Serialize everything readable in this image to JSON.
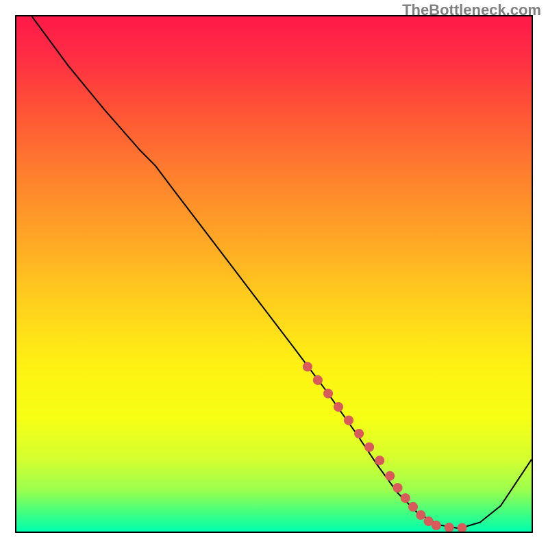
{
  "watermark": "TheBottleneck.com",
  "chart_data": {
    "type": "line",
    "title": "",
    "xlabel": "",
    "ylabel": "",
    "xlim": [
      0,
      100
    ],
    "ylim": [
      0,
      100
    ],
    "background_gradient": {
      "stops": [
        {
          "offset": 0.0,
          "color": "#ff1a49"
        },
        {
          "offset": 0.08,
          "color": "#ff2e44"
        },
        {
          "offset": 0.18,
          "color": "#ff5236"
        },
        {
          "offset": 0.3,
          "color": "#ff7d2e"
        },
        {
          "offset": 0.42,
          "color": "#ffa326"
        },
        {
          "offset": 0.55,
          "color": "#ffce1d"
        },
        {
          "offset": 0.68,
          "color": "#fff213"
        },
        {
          "offset": 0.78,
          "color": "#f6ff14"
        },
        {
          "offset": 0.86,
          "color": "#d4ff30"
        },
        {
          "offset": 0.92,
          "color": "#9aff4e"
        },
        {
          "offset": 0.965,
          "color": "#3fff82"
        },
        {
          "offset": 1.0,
          "color": "#00ffb0"
        }
      ]
    },
    "series": [
      {
        "name": "curve",
        "type": "line",
        "x": [
          3,
          10,
          17,
          24,
          27,
          30,
          38,
          46,
          54,
          60,
          66,
          70,
          74,
          78,
          82,
          86,
          90,
          94,
          100
        ],
        "y": [
          100,
          90.5,
          82,
          74,
          71,
          67,
          56.5,
          46,
          35.5,
          27.5,
          19,
          13,
          7.5,
          3.5,
          1.3,
          0.6,
          1.8,
          5.0,
          14
        ]
      },
      {
        "name": "highlight-dots",
        "type": "scatter",
        "x": [
          56.5,
          58.5,
          60.5,
          62.5,
          64.5,
          66.5,
          68.5,
          70.5,
          72.5,
          74.0,
          75.5,
          77.0,
          78.5,
          80.0,
          81.5,
          84.0,
          86.5
        ],
        "y": [
          32.0,
          29.4,
          26.8,
          24.2,
          21.6,
          19.0,
          16.4,
          13.8,
          10.8,
          8.5,
          6.5,
          4.8,
          3.2,
          2.0,
          1.2,
          0.8,
          0.7
        ]
      }
    ]
  }
}
